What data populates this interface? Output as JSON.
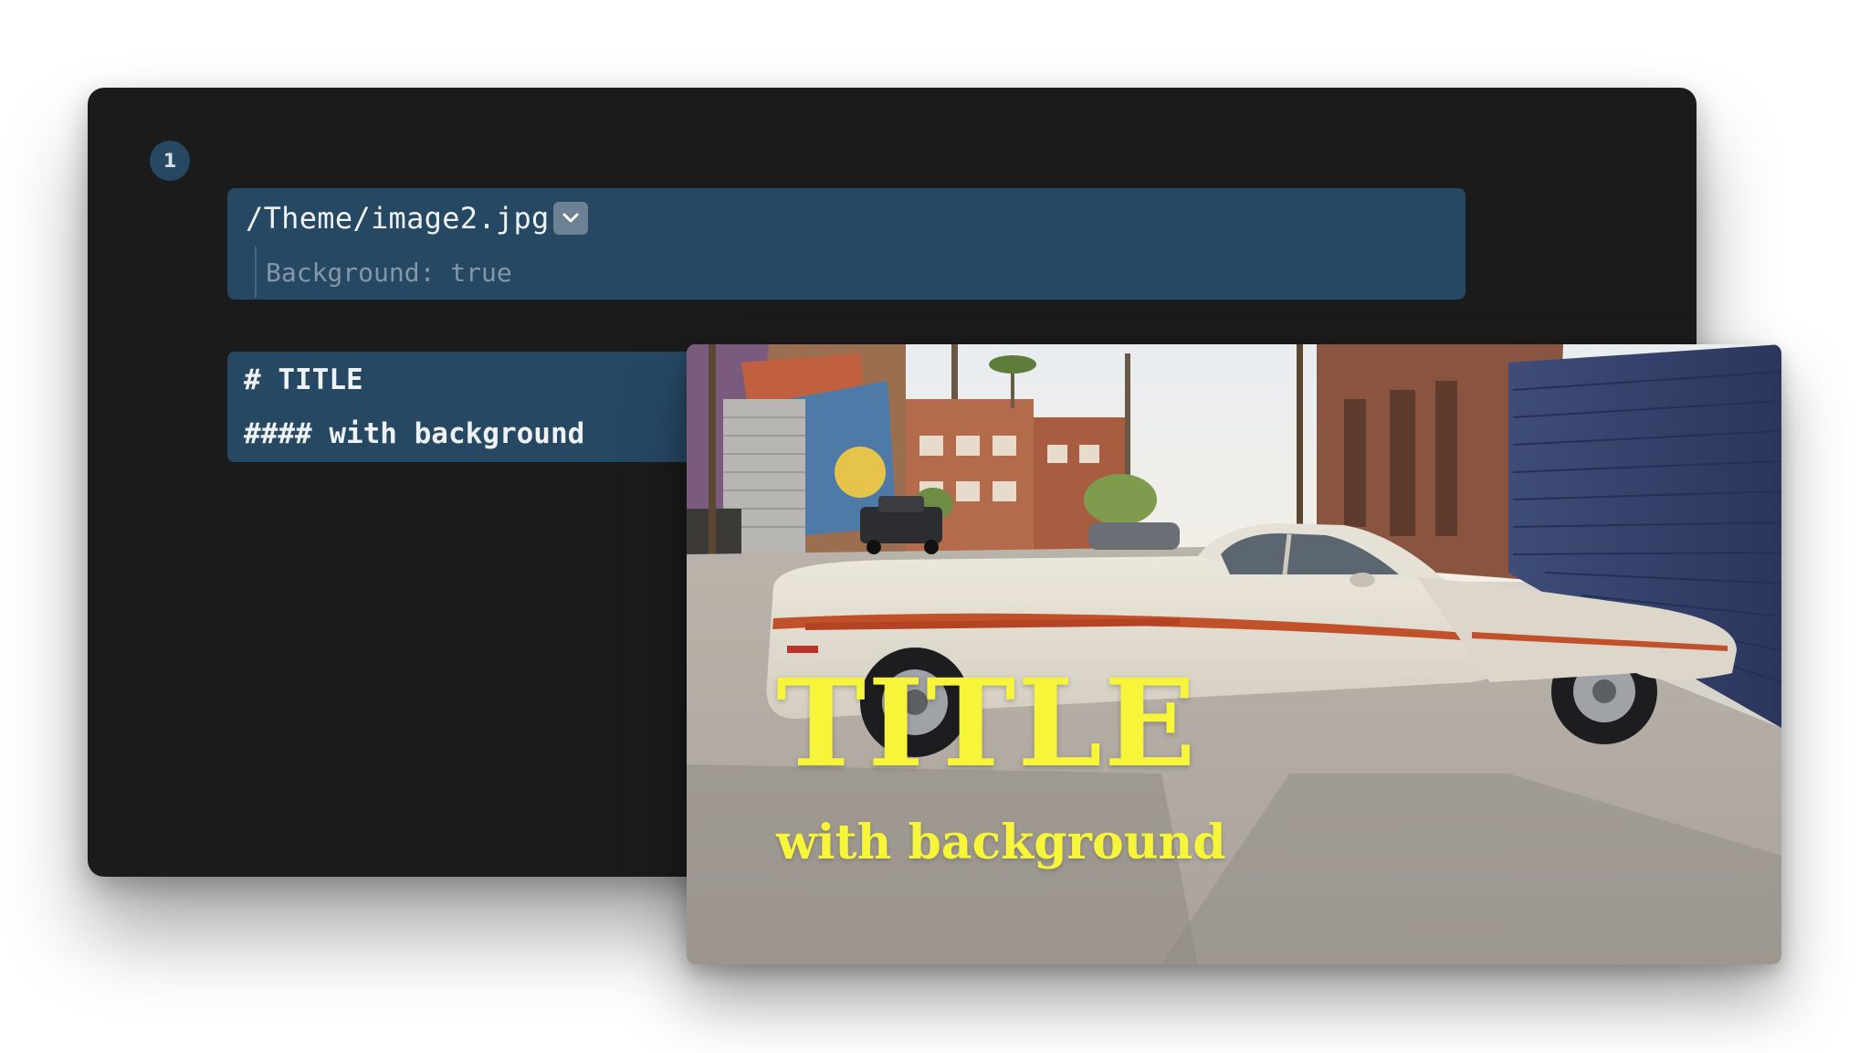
{
  "editor": {
    "slide_number": "1",
    "image_block": {
      "path": "/Theme/image2.jpg",
      "option": "Background: true",
      "dropdown_icon": "chevron-down-icon"
    },
    "markdown_block": {
      "line1": "# TITLE",
      "line2": "#### with background"
    }
  },
  "preview": {
    "title": "TITLE",
    "subtitle": "with background",
    "text_color": "#f7f53a",
    "background_image": "street-with-vintage-white-car-photo"
  },
  "colors": {
    "editor_bg": "#1b1b1c",
    "block_bg": "#274863",
    "block_text": "#eef2f6",
    "option_text": "#8497a8"
  }
}
